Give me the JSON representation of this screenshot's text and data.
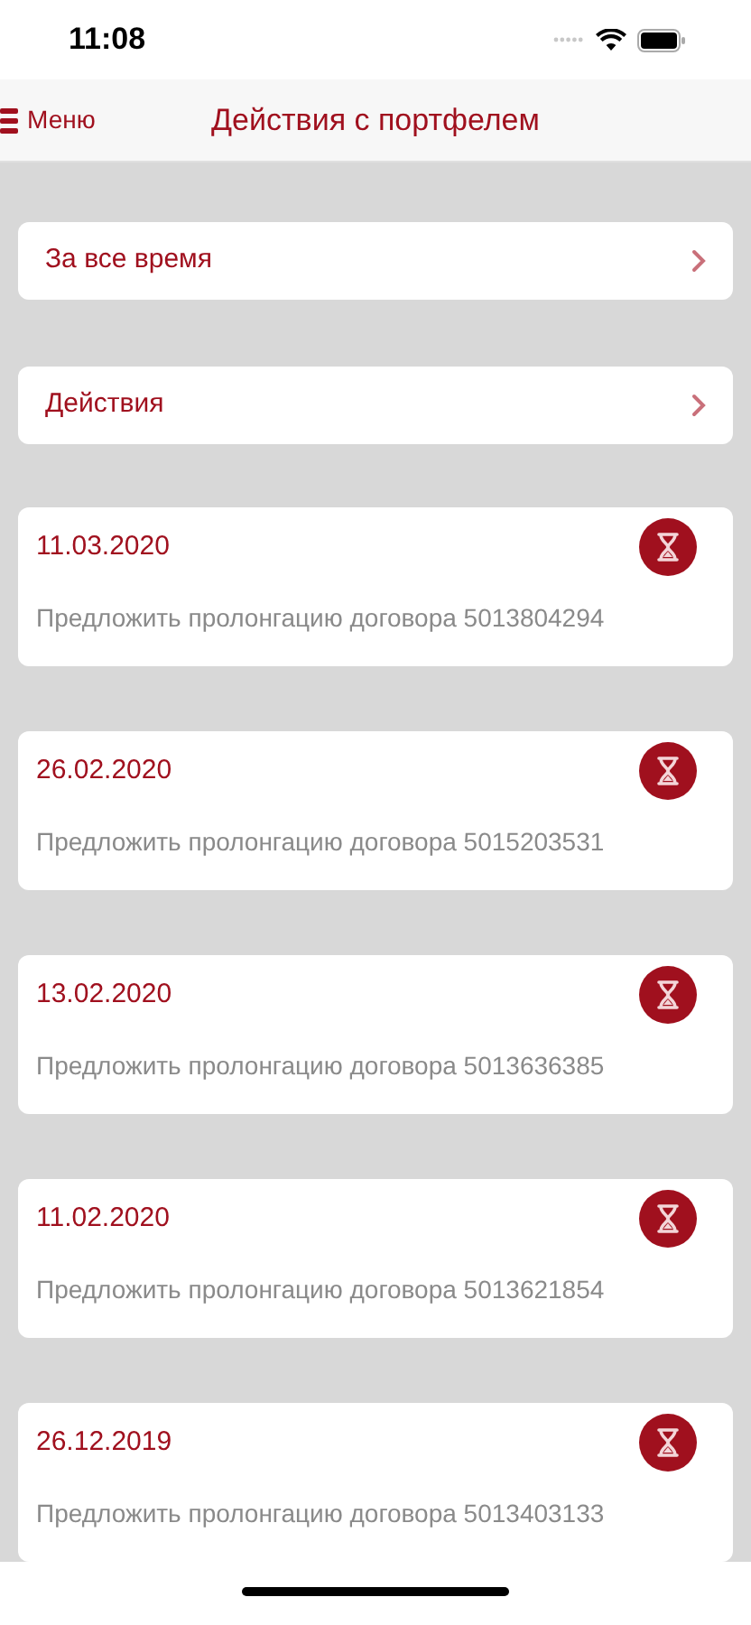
{
  "status_bar": {
    "time": "11:08"
  },
  "nav": {
    "menu_label": "Меню",
    "title": "Действия с портфелем"
  },
  "filters": [
    {
      "label": "За все время"
    },
    {
      "label": "Действия"
    }
  ],
  "actions": [
    {
      "date": "11.03.2020",
      "text": "Предложить пролонгацию договора 5013804294"
    },
    {
      "date": "26.02.2020",
      "text": "Предложить пролонгацию договора 5015203531"
    },
    {
      "date": "13.02.2020",
      "text": "Предложить пролонгацию договора 5013636385"
    },
    {
      "date": "11.02.2020",
      "text": "Предложить пролонгацию договора 5013621854"
    },
    {
      "date": "26.12.2019",
      "text": "Предложить пролонгацию договора 5013403133"
    }
  ]
}
